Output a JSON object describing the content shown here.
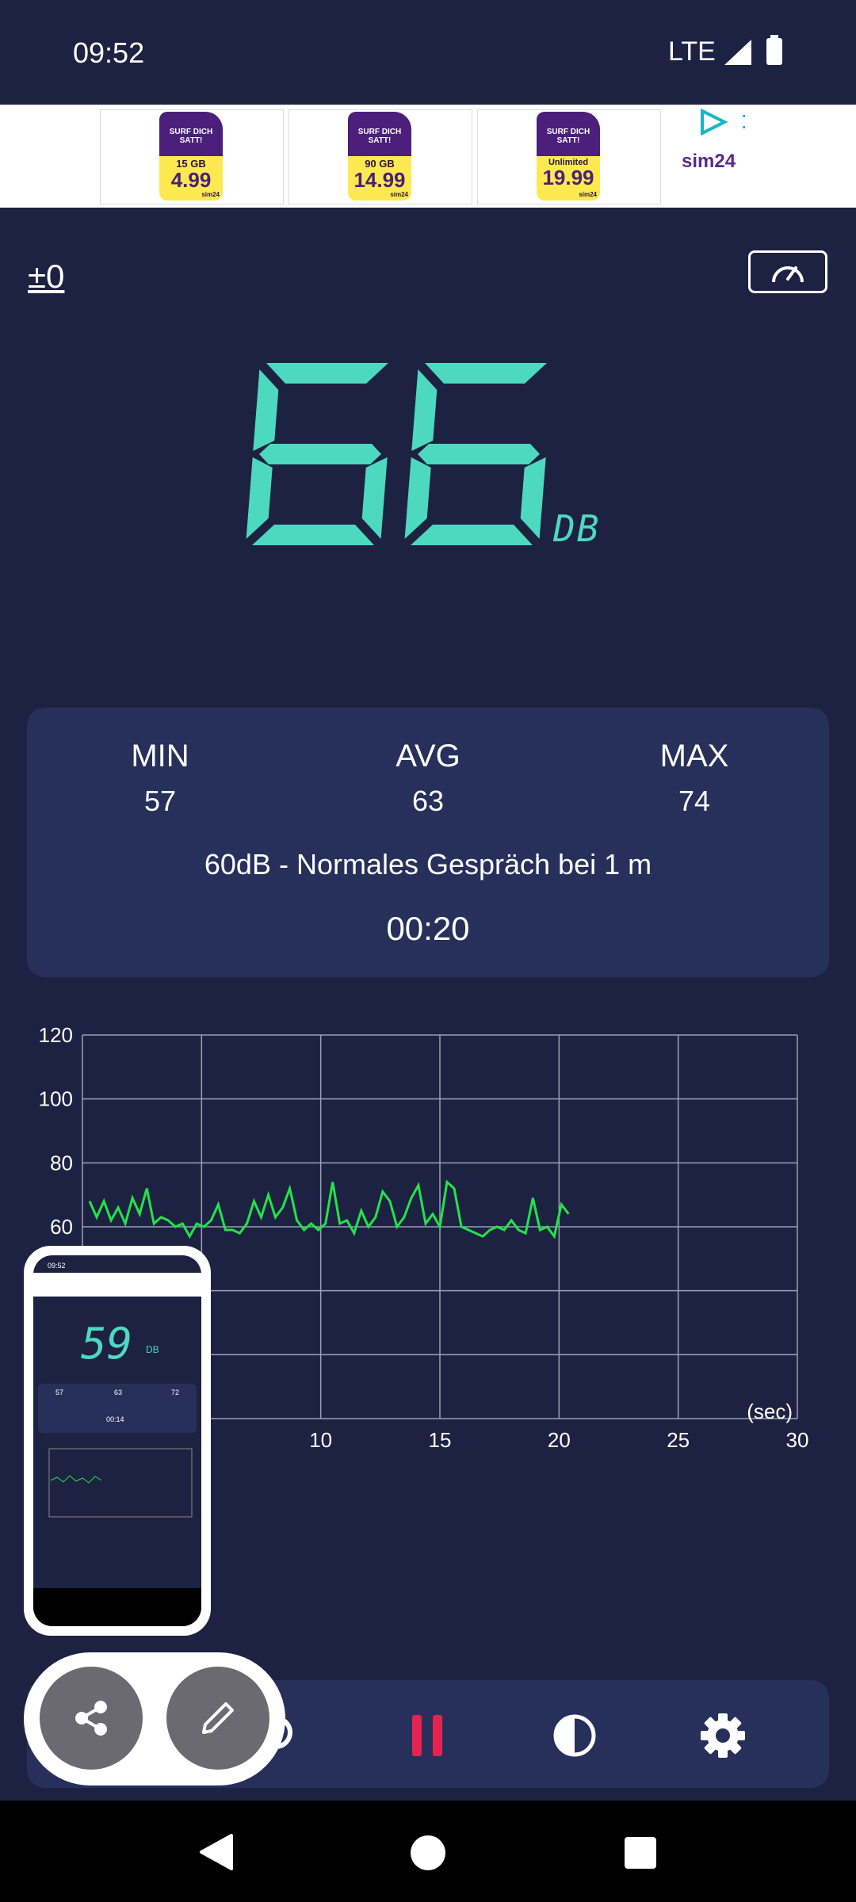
{
  "status_bar": {
    "time": "09:52",
    "network": "LTE"
  },
  "ad": {
    "cards": [
      {
        "headline": "SURF DICH SATT!",
        "plan": "15 GB",
        "price": "4.99",
        "brand": "sim24"
      },
      {
        "headline": "SURF DICH SATT!",
        "plan": "90 GB",
        "price": "14.99",
        "brand": "sim24"
      },
      {
        "headline": "SURF DICH SATT!",
        "plan": "Unlimited",
        "price": "19.99",
        "brand": "sim24"
      }
    ],
    "logo": "sim24"
  },
  "meter": {
    "calibration": "±0",
    "level": "66",
    "unit": "DB"
  },
  "stats": {
    "min_label": "MIN",
    "min_value": "57",
    "avg_label": "AVG",
    "avg_value": "63",
    "max_label": "MAX",
    "max_value": "74",
    "description": "60dB - Normales Gespräch bei 1 m",
    "elapsed": "00:20"
  },
  "chart_data": {
    "type": "line",
    "xlabel": "(sec)",
    "ylabel": "",
    "xlim": [
      0,
      30
    ],
    "ylim": [
      0,
      120
    ],
    "x_ticks": [
      0,
      5,
      10,
      15,
      20,
      25,
      30
    ],
    "x_tick_labels": [
      "",
      "",
      "10",
      "15",
      "20",
      "25",
      "30"
    ],
    "y_ticks": [
      0,
      20,
      40,
      60,
      80,
      100,
      120
    ],
    "y_tick_labels": [
      "",
      "",
      "",
      "60",
      "80",
      "100",
      "120"
    ],
    "grid": true,
    "series": [
      {
        "color": "#22e34a",
        "x": [
          0.3,
          0.6,
          0.9,
          1.2,
          1.5,
          1.8,
          2.1,
          2.4,
          2.7,
          3.0,
          3.3,
          3.6,
          3.9,
          4.2,
          4.5,
          4.8,
          5.1,
          5.4,
          5.7,
          6.0,
          6.3,
          6.6,
          6.9,
          7.2,
          7.5,
          7.8,
          8.1,
          8.4,
          8.7,
          9.0,
          9.3,
          9.6,
          9.9,
          10.2,
          10.5,
          10.8,
          11.1,
          11.4,
          11.7,
          12.0,
          12.3,
          12.6,
          12.9,
          13.2,
          13.5,
          13.8,
          14.1,
          14.4,
          14.7,
          15.0,
          15.3,
          15.6,
          15.9,
          16.2,
          16.5,
          16.8,
          17.1,
          17.4,
          17.7,
          18.0,
          18.3,
          18.6,
          18.9,
          19.2,
          19.5,
          19.8,
          20.1,
          20.4
        ],
        "values": [
          68,
          63,
          68,
          62,
          66,
          61,
          69,
          64,
          72,
          61,
          63,
          62,
          60,
          61,
          57,
          61,
          60,
          62,
          67,
          59,
          59,
          58,
          61,
          68,
          63,
          70,
          63,
          66,
          72,
          62,
          59,
          61,
          59,
          61,
          74,
          61,
          62,
          58,
          65,
          60,
          63,
          71,
          68,
          60,
          63,
          69,
          73,
          61,
          64,
          60,
          74,
          72,
          60,
          59,
          58,
          57,
          59,
          60,
          59,
          62,
          59,
          58,
          69,
          59,
          60,
          57,
          67,
          64
        ]
      }
    ]
  },
  "preview": {
    "level": "59",
    "unit": "DB",
    "min": "57",
    "avg": "63",
    "max": "72",
    "time": "00:14",
    "status_time": "09:52"
  },
  "toolbar": {
    "items": [
      "reset-icon",
      "pause-icon",
      "contrast-icon",
      "settings-icon"
    ]
  },
  "colors": {
    "background": "#1d2242",
    "card": "#27305a",
    "accent": "#4dd9c0",
    "line": "#22e34a",
    "pause": "#e8224f"
  }
}
